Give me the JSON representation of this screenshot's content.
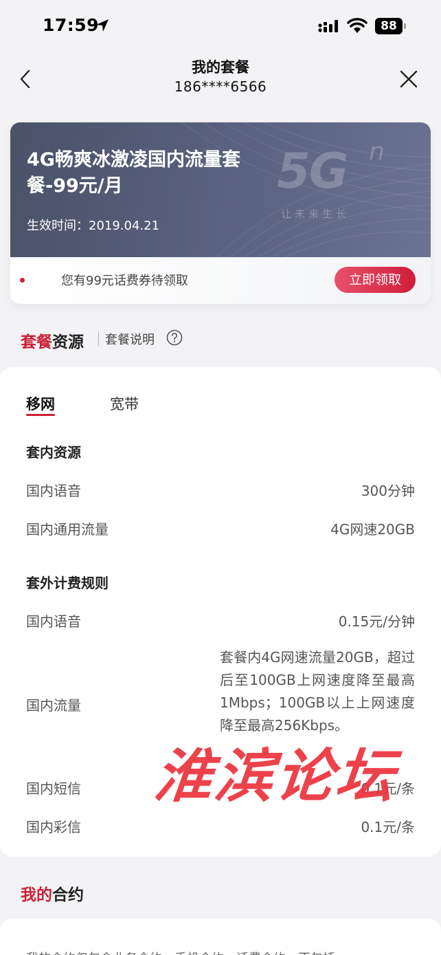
{
  "status_bar": {
    "time": "17:59",
    "battery": "88"
  },
  "header": {
    "title": "我的套餐",
    "phone": "186****6566"
  },
  "plan": {
    "name": "4G畅爽冰激凌国内流量套餐-99元/月",
    "effective_label": "生效时间：",
    "effective_date": "2019.04.21",
    "logo_text": "5G",
    "logo_sup": "n",
    "logo_tagline": "让未来生长",
    "coupon_text": "您有99元话费券待领取",
    "claim_label": "立即领取"
  },
  "resources_section": {
    "title_accent": "套餐",
    "title_rest": "资源",
    "desc_link": "套餐说明"
  },
  "tabs": [
    {
      "label": "移网",
      "active": true
    },
    {
      "label": "宽带",
      "active": false
    }
  ],
  "included": {
    "title": "套内资源",
    "rows": [
      {
        "label": "国内语音",
        "value": "300分钟"
      },
      {
        "label": "国内通用流量",
        "value": "4G网速20GB"
      }
    ]
  },
  "overage": {
    "title": "套外计费规则",
    "rows": [
      {
        "label": "国内语音",
        "value": "0.15元/分钟"
      },
      {
        "label": "国内流量",
        "value": "套餐内4G网速流量20GB，超过后至100GB上网速度降至最高1Mbps；100GB以上上网速度降至最高256Kbps。"
      },
      {
        "label": "国内短信",
        "value": "0.1元/条"
      },
      {
        "label": "国内彩信",
        "value": "0.1元/条"
      }
    ]
  },
  "contract": {
    "title_accent": "我的",
    "title_rest": "合约",
    "text": "我的合约仅包含业务合约、手机合约、话费合约，不包括..."
  },
  "watermark": "淮滨论坛",
  "colors": {
    "accent": "#cc1f36",
    "banner": "#525a72",
    "background": "#f3f3f5"
  }
}
